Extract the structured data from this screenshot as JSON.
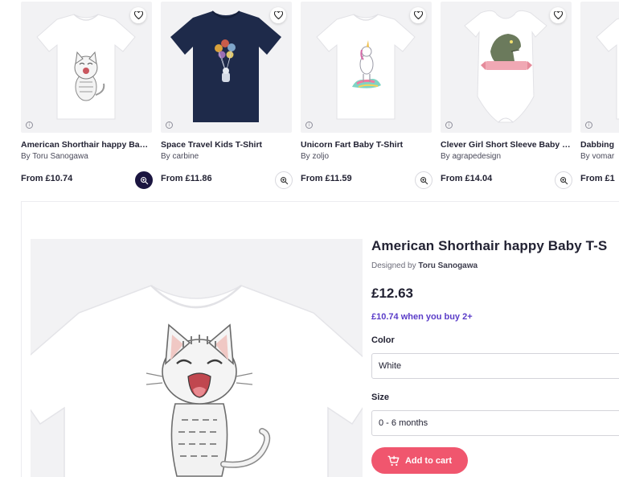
{
  "carousel": {
    "cards": [
      {
        "title": "American Shorthair happy Baby T-Shirt",
        "artist": "By Toru Sanogawa",
        "price": "From £10.74",
        "zoom_active": true
      },
      {
        "title": "Space Travel Kids T-Shirt",
        "artist": "By carbine",
        "price": "From £11.86",
        "zoom_active": false
      },
      {
        "title": "Unicorn Fart Baby T-Shirt",
        "artist": "By zoljo",
        "price": "From £11.59",
        "zoom_active": false
      },
      {
        "title": "Clever Girl Short Sleeve Baby One-Piece",
        "artist": "By agrapedesign",
        "price": "From £14.04",
        "zoom_active": false
      },
      {
        "title": "Dabbing",
        "artist": "By vomar",
        "price": "From £1",
        "zoom_active": false
      }
    ],
    "info_glyph": "i"
  },
  "product": {
    "title": "American Shorthair happy Baby T-S",
    "designed_by_prefix": "Designed by",
    "designer": "Toru Sanogawa",
    "price": "£12.63",
    "bulk_offer": "£10.74 when you buy 2+",
    "color_label": "Color",
    "color_value": "White",
    "size_label": "Size",
    "size_value": "0 - 6 months",
    "add_to_cart_label": "Add to cart"
  },
  "colors": {
    "accent": "#f0566e",
    "bulk_text": "#5a3cc8",
    "zoom_active_bg": "#1b1540",
    "navy_shirt": "#1e2a4a",
    "tile_bg": "#f2f2f4"
  },
  "icons": {
    "heart": "heart-icon",
    "zoom": "zoom-icon",
    "info": "info-icon",
    "cart": "cart-icon"
  }
}
